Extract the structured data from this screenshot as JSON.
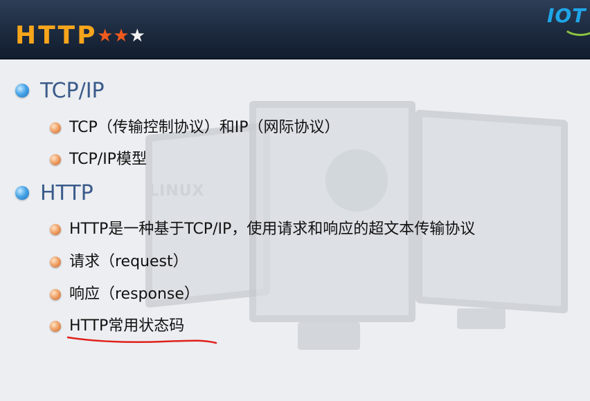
{
  "header": {
    "title": "HTTP",
    "stars": [
      "★",
      "★",
      "★"
    ],
    "rating": {
      "filled": 2,
      "total": 3
    },
    "logo_text": "IOT",
    "colors": {
      "title": "#f7a51b",
      "star_on": "#f05a1d",
      "star_off": "#f2f2f2",
      "logo": "#1fa6e8",
      "bar": "#1c2a3f"
    }
  },
  "background": {
    "watermark": "LINUX"
  },
  "content": {
    "sections": [
      {
        "title": "TCP/IP",
        "items": [
          "TCP（传输控制协议）和IP（网际协议）",
          "TCP/IP模型"
        ]
      },
      {
        "title": "HTTP",
        "items": [
          "HTTP是一种基于TCP/IP，使用请求和响应的超文本传输协议",
          "请求（request）",
          "响应（response）",
          "HTTP常用状态码"
        ]
      }
    ]
  },
  "annotation": {
    "underlined_item": "HTTP常用状态码",
    "color": "#e0201a"
  }
}
